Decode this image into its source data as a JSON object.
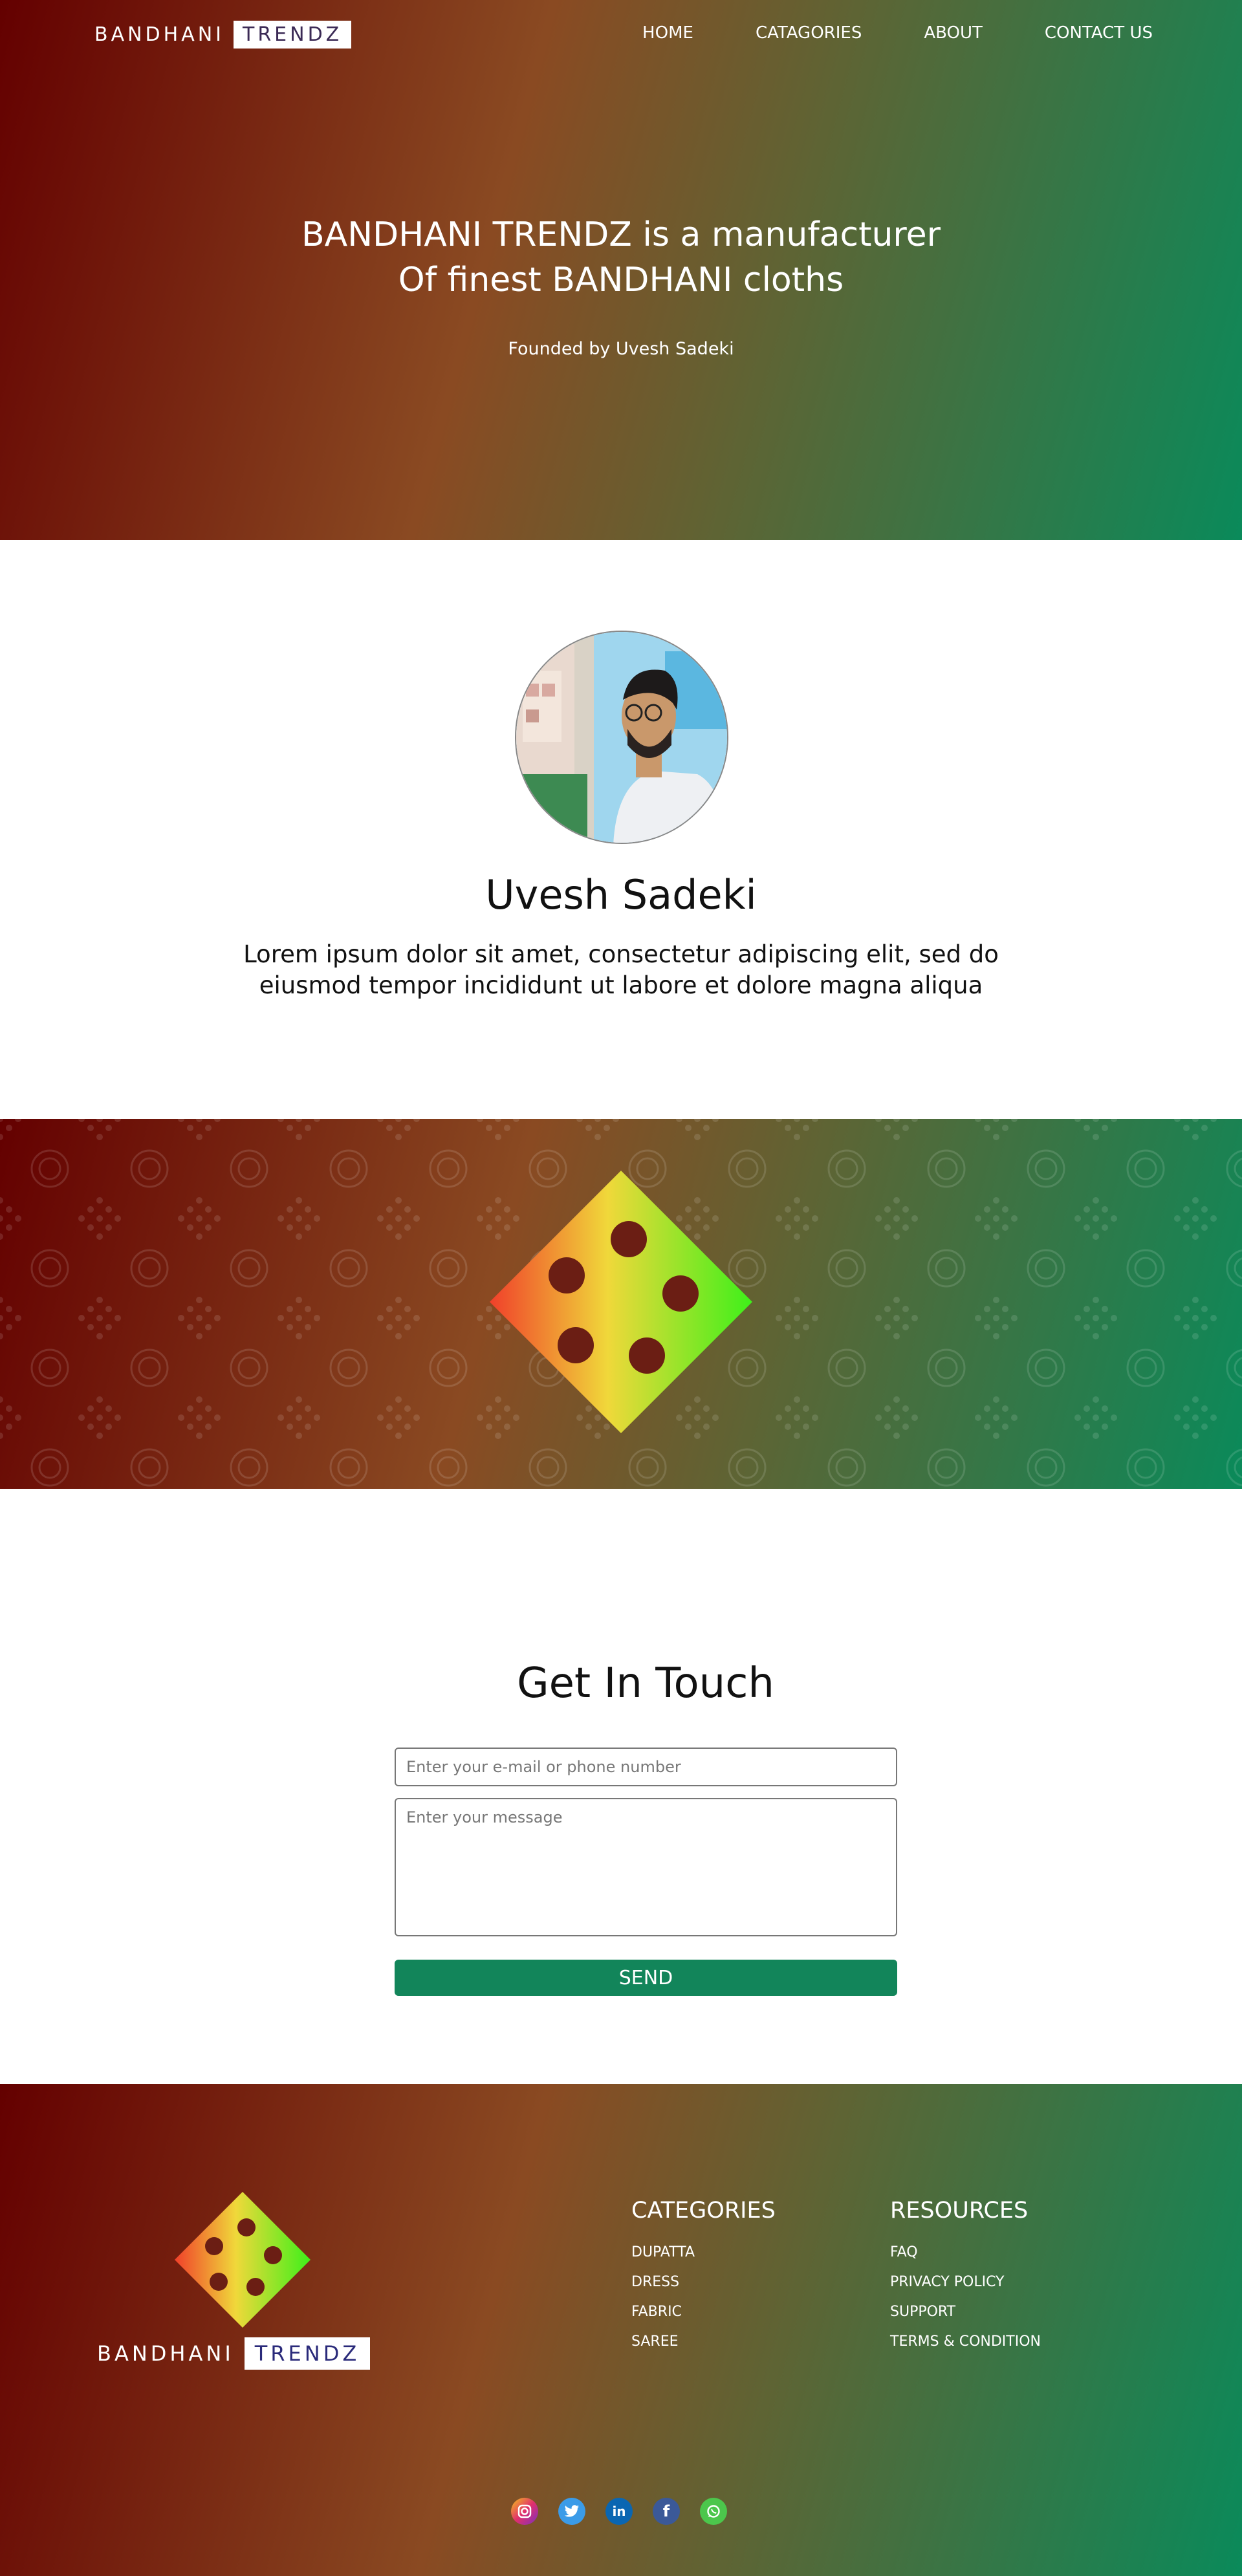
{
  "header": {
    "brand_left": "BANDHANI",
    "brand_box": "TRENDZ",
    "nav": [
      "HOME",
      "CATAGORIES",
      "ABOUT",
      "CONTACT US"
    ]
  },
  "hero": {
    "title_line1": "BANDHANI TRENDZ is a manufacturer",
    "title_line2": "Of finest BANDHANI cloths",
    "subtitle": "Founded by Uvesh Sadeki"
  },
  "founder": {
    "name": "Uvesh Sadeki",
    "description": "Lorem ipsum dolor sit amet, consectetur adipiscing elit, sed do eiusmod tempor incididunt ut labore et dolore magna aliqua"
  },
  "contact": {
    "title": "Get In Touch",
    "email_placeholder": "Enter your e-mail or phone number",
    "message_placeholder": "Enter your message",
    "send_label": "SEND"
  },
  "footer": {
    "brand_left": "BANDHANI",
    "brand_box": "TRENDZ",
    "categories": {
      "title": "CATEGORIES",
      "items": [
        "DUPATTA",
        "DRESS",
        "FABRIC",
        "SAREE"
      ]
    },
    "resources": {
      "title": "RESOURCES",
      "items": [
        "FAQ",
        "PRIVACY POLICY",
        "SUPPORT",
        "TERMS & CONDITION"
      ]
    },
    "social_icons": [
      "instagram-icon",
      "twitter-icon",
      "linkedin-icon",
      "facebook-icon",
      "whatsapp-icon"
    ]
  },
  "colors": {
    "gradient_start": "#640000",
    "gradient_mid": "#8a4a22",
    "gradient_end": "#0a8a5a",
    "send_button": "#12855a"
  }
}
